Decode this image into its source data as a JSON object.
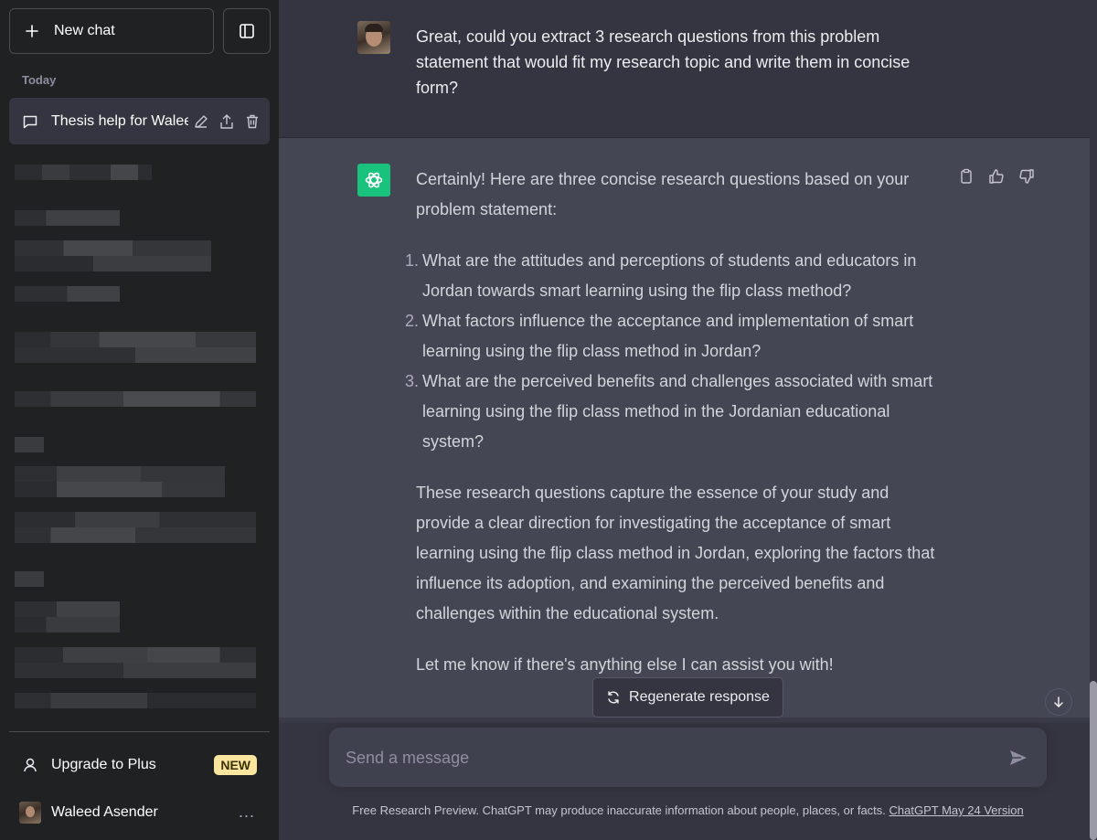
{
  "sidebar": {
    "new_chat_label": "New chat",
    "section_label": "Today",
    "active_chat_title": "Thesis help for Waleed",
    "upgrade_label": "Upgrade to Plus",
    "upgrade_badge": "NEW",
    "user_name": "Waleed Asender",
    "more_label": "..."
  },
  "conversation": {
    "user_message": "Great, could you extract 3 research questions from this problem statement that would fit my research topic and write them in concise form?",
    "assistant_intro": "Certainly! Here are three concise research questions based on your problem statement:",
    "questions": [
      {
        "num": "1.",
        "text": "What are the attitudes and perceptions of students and educators in Jordan towards smart learning using the flip class method?"
      },
      {
        "num": "2.",
        "text": "What factors influence the acceptance and implementation of smart learning using the flip class method in Jordan?"
      },
      {
        "num": "3.",
        "text": "What are the perceived benefits and challenges associated with smart learning using the flip class method in the Jordanian educational system?"
      }
    ],
    "assistant_summary": "These research questions capture the essence of your study and provide a clear direction for investigating the acceptance of smart learning using the flip class method in Jordan, exploring the factors that influence its adoption, and examining the perceived benefits and challenges within the educational system.",
    "assistant_closing": "Let me know if there's anything else I can assist you with!"
  },
  "composer": {
    "regenerate_label": "Regenerate response",
    "placeholder": "Send a message",
    "footer_text": "Free Research Preview. ChatGPT may produce inaccurate information about people, places, or facts.",
    "footer_link": "ChatGPT May 24 Version"
  },
  "colors": {
    "sidebar_bg": "#202123",
    "main_bg": "#343541",
    "assistant_bg": "#444654",
    "gpt_green": "#19c37d",
    "badge_bg": "#fae69e"
  },
  "icons": {
    "new_chat": "plus-icon",
    "toggle": "sidebar-toggle-icon",
    "chat": "chat-bubble-icon",
    "edit": "pencil-icon",
    "share": "share-icon",
    "delete": "trash-icon",
    "upgrade": "user-icon",
    "copy": "clipboard-icon",
    "like": "thumbs-up-icon",
    "dislike": "thumbs-down-icon",
    "regenerate": "refresh-icon",
    "scroll_down": "arrow-down-icon",
    "send": "send-icon",
    "assistant": "openai-logo-icon"
  }
}
